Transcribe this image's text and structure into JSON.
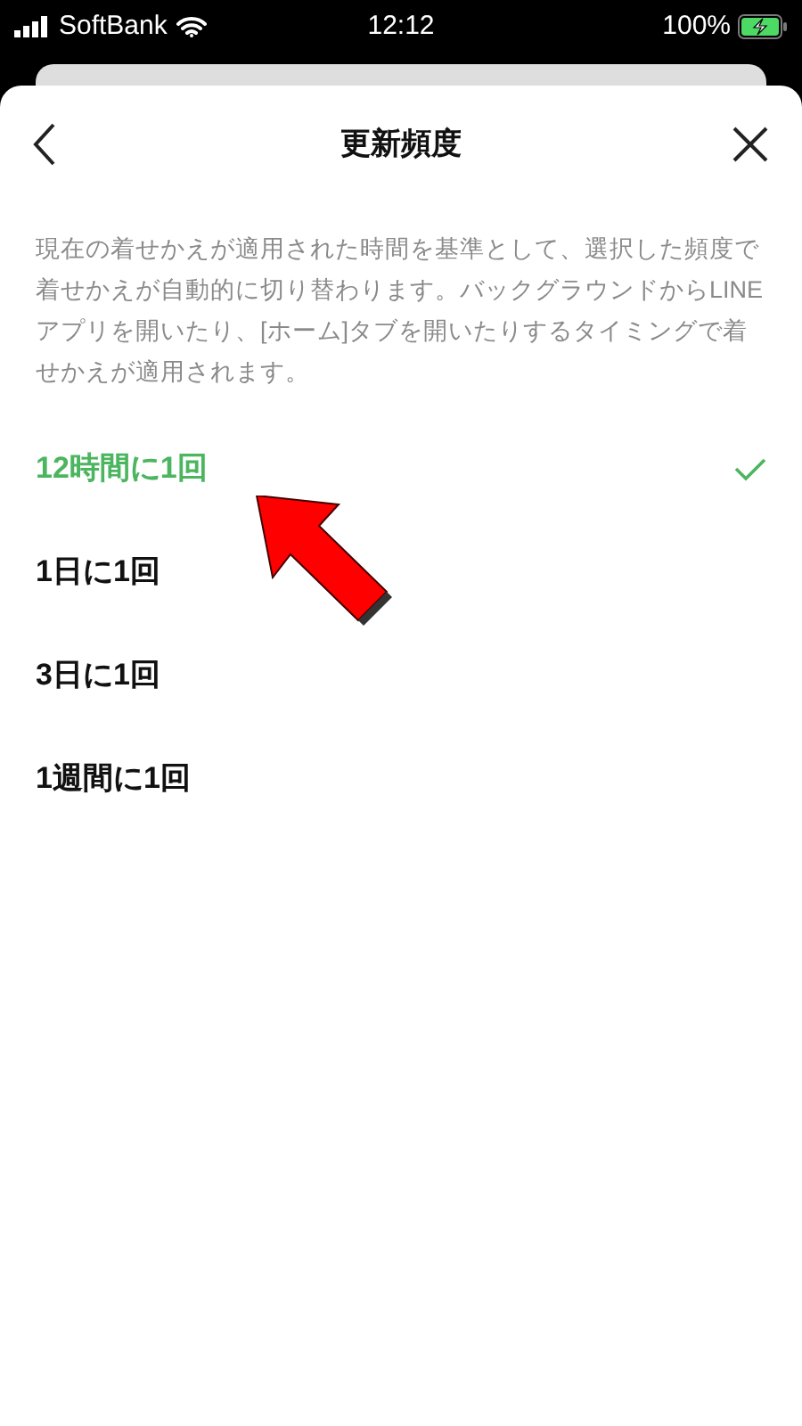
{
  "status_bar": {
    "carrier": "SoftBank",
    "time": "12:12",
    "battery": "100%"
  },
  "header": {
    "title": "更新頻度"
  },
  "description": "現在の着せかえが適用された時間を基準として、選択した頻度で着せかえが自動的に切り替わります。バックグラウンドからLINEアプリを開いたり、[ホーム]タブを開いたりするタイミングで着せかえが適用されます。",
  "options": [
    {
      "label": "12時間に1回",
      "selected": true
    },
    {
      "label": "1日に1回",
      "selected": false
    },
    {
      "label": "3日に1回",
      "selected": false
    },
    {
      "label": "1週間に1回",
      "selected": false
    }
  ]
}
